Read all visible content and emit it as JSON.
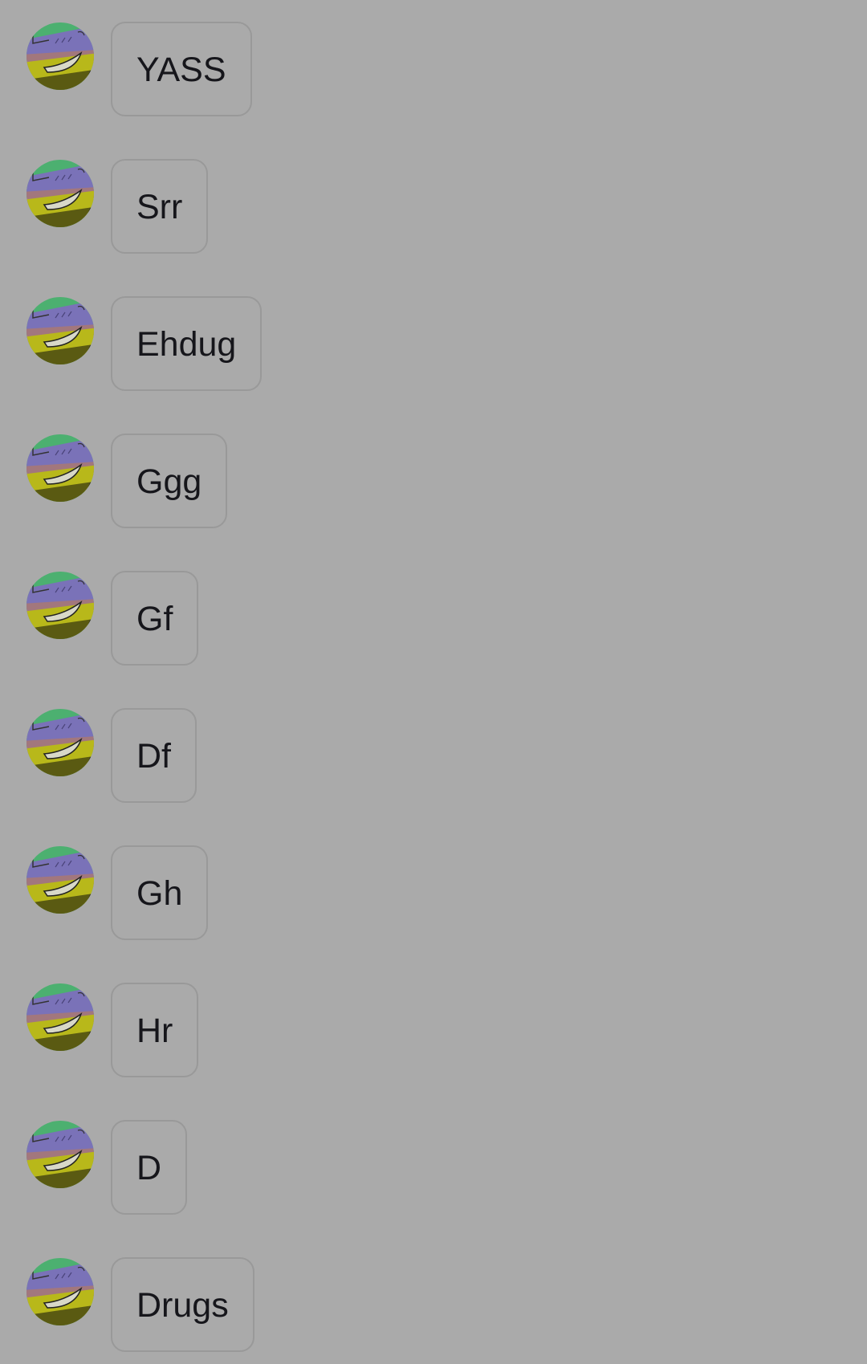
{
  "chat": {
    "avatar_icon": "user-avatar-cartoon-face-icon",
    "colors": {
      "background": "#aaaaaa",
      "bubble_border": "#999999",
      "text": "#16161b"
    },
    "messages": [
      {
        "text": "YASS"
      },
      {
        "text": "Srr"
      },
      {
        "text": "Ehdug"
      },
      {
        "text": "Ggg"
      },
      {
        "text": "Gf"
      },
      {
        "text": "Df"
      },
      {
        "text": "Gh"
      },
      {
        "text": "Hr"
      },
      {
        "text": "D"
      },
      {
        "text": "Drugs"
      }
    ]
  }
}
